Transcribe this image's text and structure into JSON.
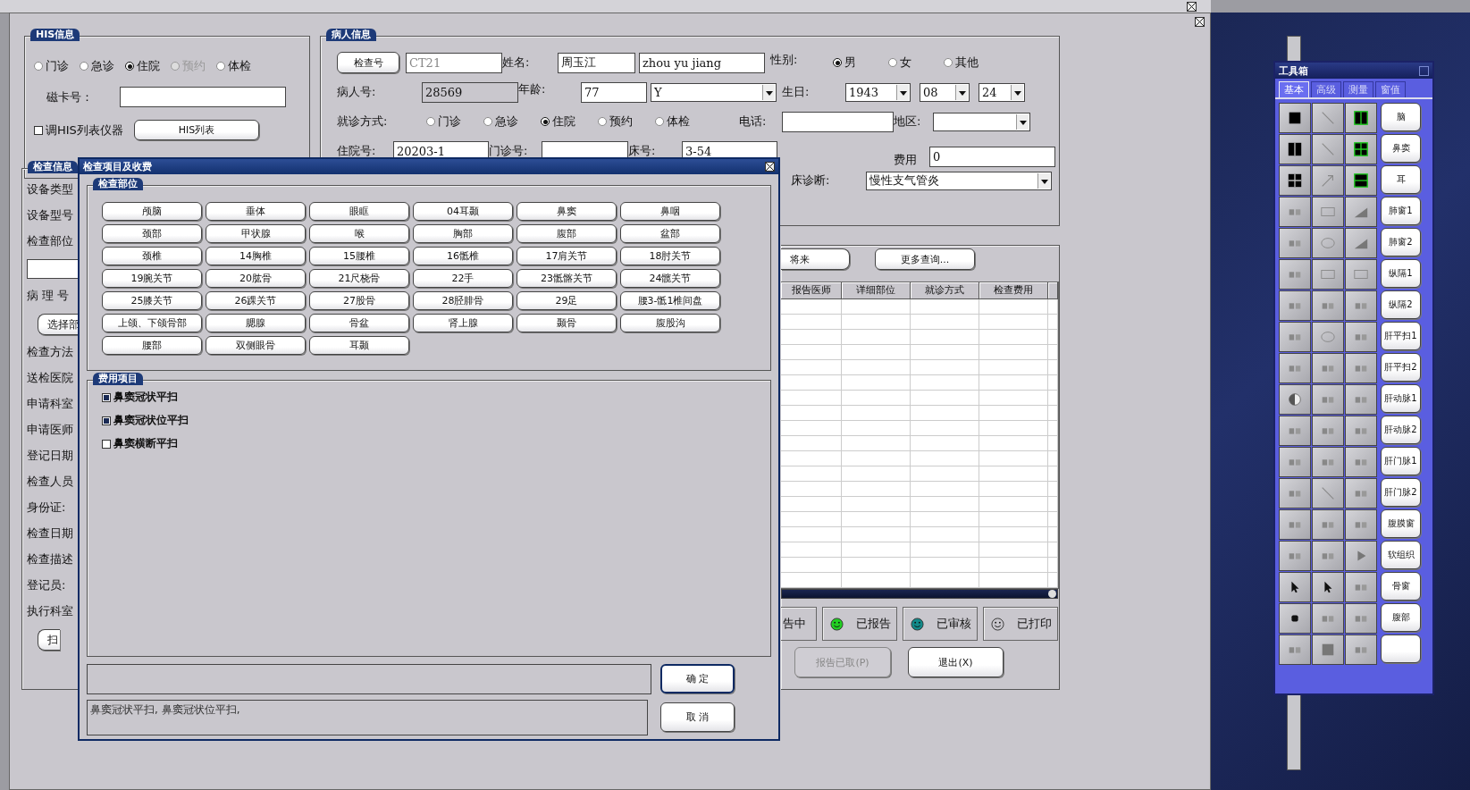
{
  "his": {
    "title": "HIS信息",
    "visit_types": [
      {
        "label": "门诊",
        "selected": false,
        "disabled": false
      },
      {
        "label": "急诊",
        "selected": false,
        "disabled": false
      },
      {
        "label": "住院",
        "selected": true,
        "disabled": false
      },
      {
        "label": "预约",
        "selected": false,
        "disabled": true
      },
      {
        "label": "体检",
        "selected": false,
        "disabled": false
      }
    ],
    "card_label": "磁卡号：",
    "device": {
      "label": "调HIS列表仪器",
      "checked": false
    },
    "list_button": "HIS列表"
  },
  "patient": {
    "title": "病人信息",
    "exam_no_button": "检查号",
    "exam_no": "CT21",
    "name_label": "姓名:",
    "name": "周玉江",
    "name_pinyin": "zhou yu jiang",
    "sex_label": "性别:",
    "sexes": [
      {
        "label": "男",
        "selected": true
      },
      {
        "label": "女",
        "selected": false
      },
      {
        "label": "其他",
        "selected": false
      }
    ],
    "patient_no_label": "病人号:",
    "patient_no": "28569",
    "age_label": "年龄:",
    "age": "77",
    "age_unit": "Y",
    "birthday_label": "生日:",
    "birth_year": "1943",
    "birth_month": "08",
    "birth_day": "24",
    "visit_label": "就诊方式:",
    "visit_types": [
      {
        "label": "门诊",
        "selected": false
      },
      {
        "label": "急诊",
        "selected": false
      },
      {
        "label": "住院",
        "selected": true
      },
      {
        "label": "预约",
        "selected": false
      },
      {
        "label": "体检",
        "selected": false
      }
    ],
    "phone_label": "电话:",
    "region_label": "地区:",
    "inpatient_no_label": "住院号:",
    "inpatient_no": "20203-1",
    "outpatient_no_label": "门诊号:",
    "bed_label": "床号:",
    "bed": "3-54",
    "fee_label": "费用",
    "fee": "0",
    "diagnosis_label": "床诊断:",
    "diagnosis": "慢性支气管炎"
  },
  "exam_info": {
    "title": "检查信息",
    "items": [
      {
        "kind": "label",
        "text": "设备类型"
      },
      {
        "kind": "label",
        "text": "设备型号"
      },
      {
        "kind": "label",
        "text": "检查部位"
      },
      {
        "kind": "field"
      },
      {
        "kind": "label",
        "text": "病 理 号"
      },
      {
        "kind": "button",
        "text": "选择部"
      },
      {
        "kind": "label",
        "text": "检查方法"
      },
      {
        "kind": "label",
        "text": "送检医院"
      },
      {
        "kind": "label",
        "text": "申请科室"
      },
      {
        "kind": "label",
        "text": "申请医师"
      },
      {
        "kind": "label",
        "text": "登记日期"
      },
      {
        "kind": "label",
        "text": "检查人员"
      },
      {
        "kind": "label",
        "text": "身份证:"
      },
      {
        "kind": "label",
        "text": "检查日期"
      },
      {
        "kind": "label",
        "text": "检查描述"
      },
      {
        "kind": "label",
        "text": "登记员:"
      },
      {
        "kind": "label",
        "text": "执行科室"
      },
      {
        "kind": "button",
        "text": "扫"
      }
    ]
  },
  "list_panel": {
    "buttons": [
      "将来",
      "更多查询..."
    ],
    "columns": [
      "报告医师",
      "详细部位",
      "就诊方式",
      "检查费用"
    ],
    "statuses": [
      {
        "label": "告中"
      },
      {
        "label": "已报告",
        "color": "#22d022"
      },
      {
        "label": "已审核",
        "color": "#138a8a"
      },
      {
        "label": "已打印",
        "color": "#c8c6cc"
      }
    ],
    "fetched_button": {
      "label": "报告已取(P)",
      "disabled": true
    },
    "exit_button": "退出(X)"
  },
  "dialog": {
    "title": "检查项目及收费",
    "parts_title": "检查部位",
    "parts": [
      "颅脑",
      "垂体",
      "眼眶",
      "04耳颞",
      "鼻窦",
      "鼻咽",
      "颈部",
      "甲状腺",
      "喉",
      "胸部",
      "腹部",
      "盆部",
      "颈椎",
      "14胸椎",
      "15腰椎",
      "16骶椎",
      "17肩关节",
      "18肘关节",
      "19腕关节",
      "20肱骨",
      "21尺桡骨",
      "22手",
      "23骶髂关节",
      "24髋关节",
      "25膝关节",
      "26踝关节",
      "27股骨",
      "28胫腓骨",
      "29足",
      "腰3-骶1椎间盘",
      "上颌、下颌骨部",
      "腮腺",
      "骨盆",
      "肾上腺",
      "颞骨",
      "腹股沟",
      "腰部",
      "双侧眼骨",
      "耳颞"
    ],
    "fee_title": "费用项目",
    "fee_items": [
      {
        "label": "鼻窦冠状平扫",
        "checked": true
      },
      {
        "label": "鼻窦冠状位平扫",
        "checked": true
      },
      {
        "label": "鼻窦横断平扫",
        "checked": false
      }
    ],
    "summary": "鼻窦冠状平扫, 鼻窦冠状位平扫,",
    "ok": "确  定",
    "cancel": "取  消"
  },
  "toolbox": {
    "title": "工具箱",
    "tabs": [
      {
        "label": "基本",
        "selected": true
      },
      {
        "label": "高级",
        "selected": false
      },
      {
        "label": "测量",
        "selected": false
      },
      {
        "label": "窗值",
        "selected": false
      }
    ],
    "presets": [
      "脑",
      "鼻窦",
      "耳",
      "肺窗1",
      "肺窗2",
      "纵隔1",
      "纵隔2",
      "肝平扫1",
      "肝平扫2",
      "肝动脉1",
      "肝动脉2",
      "肝门脉1",
      "肝门脉2",
      "腹膜窗",
      "软组织",
      "骨窗",
      "腹部"
    ]
  }
}
